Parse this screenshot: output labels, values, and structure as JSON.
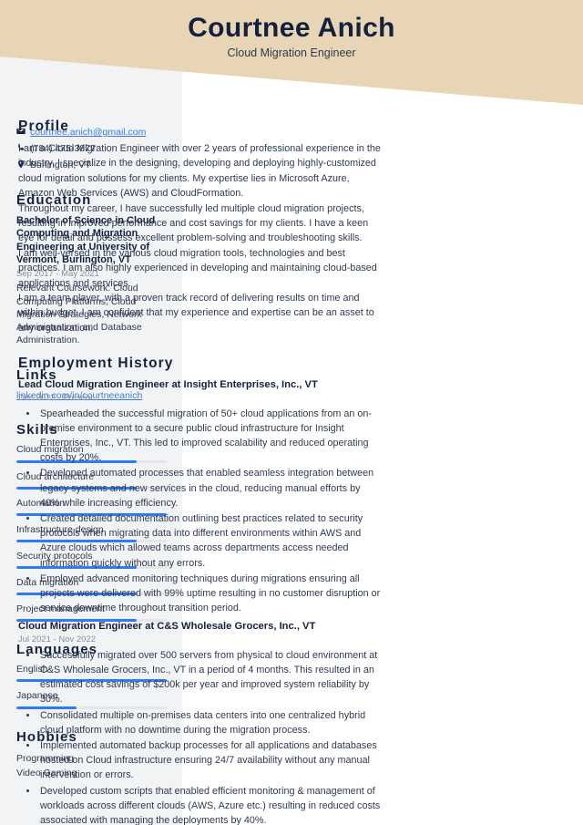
{
  "theme": {
    "banner_color": "#e8d5b5",
    "sidebar_color": "#f2f3f5",
    "accent_bar_color": "#2f7bf6",
    "heading_color": "#14213d",
    "link_color": "#3b7ddd"
  },
  "header": {
    "name": "Courtnee Anich",
    "job_title": "Cloud Migration Engineer"
  },
  "contact": {
    "email": "courtnee.anich@gmail.com",
    "phone": "(784) 475-3877",
    "location": "Burlington, VT"
  },
  "education": {
    "heading": "Education",
    "degree": "Bachelor of Science in Cloud Computing and Migration Engineering at University of Vermont, Burlington, VT",
    "date": "Sep 2017 - May 2021",
    "description": "Relevant Coursework: Cloud Computing Platforms, Cloud Migration Strategies, Network Administration, and Database Administration."
  },
  "links": {
    "heading": "Links",
    "items": [
      {
        "label": "linkedin.com/in/courtneeanich"
      }
    ]
  },
  "skills": {
    "heading": "Skills",
    "items": [
      {
        "label": "Cloud migration",
        "level": 80
      },
      {
        "label": "Cloud architecture",
        "level": 80
      },
      {
        "label": "Automation",
        "level": 100
      },
      {
        "label": "Infrastructure design",
        "level": 80
      },
      {
        "label": "Security protocols",
        "level": 80
      },
      {
        "label": "Data migration",
        "level": 80
      },
      {
        "label": "Project management",
        "level": 80
      }
    ]
  },
  "languages": {
    "heading": "Languages",
    "items": [
      {
        "label": "English",
        "level": 100
      },
      {
        "label": "Japanese",
        "level": 40
      }
    ]
  },
  "hobbies": {
    "heading": "Hobbies",
    "items": [
      {
        "label": "Programming"
      },
      {
        "label": "Video Gaming"
      }
    ]
  },
  "profile": {
    "heading": "Profile",
    "paragraphs": [
      "I am a Cloud Migration Engineer with over 2 years of professional experience in the industry. I specialize in the designing, developing and deploying highly-customized cloud migration solutions for my clients. My expertise lies in Microsoft Azure, Amazon Web Services (AWS) and CloudFormation.",
      "Throughout my career, I have successfully led multiple cloud migration projects, resulting in improved performance and cost savings for my clients. I have a keen eye for detail and possess excellent problem-solving and troubleshooting skills.",
      "I am well-versed in the various cloud migration tools, technologies and best practices. I am also highly experienced in developing and maintaining cloud-based applications and services.",
      "I am a team player, with a proven track record of delivering results on time and within budget. I am confident that my experience and expertise can be an asset to any organization."
    ]
  },
  "employment": {
    "heading": "Employment History",
    "jobs": [
      {
        "title": "Lead Cloud Migration Engineer at Insight Enterprises, Inc., VT",
        "date": "Dec 2022 - Present",
        "bullets": [
          "Spearheaded the successful migration of 50+ cloud applications from an on-premise environment to a secure public cloud infrastructure for Insight Enterprises, Inc., VT. This led to improved scalability and reduced operating costs by 20%.",
          "Developed automated processes that enabled seamless integration between legacy systems and new services in the cloud, reducing manual efforts by 40% while increasing efficiency.",
          "Created detailed documentation outlining best practices related to security protocols when migrating data into different environments within AWS and Azure clouds which allowed teams across departments access needed information quickly without any errors.",
          "Employed advanced monitoring techniques during migrations ensuring all projects were delivered with 99% uptime resulting in no customer disruption or service downtime throughout transition period."
        ]
      },
      {
        "title": "Cloud Migration Engineer at C&S Wholesale Grocers, Inc., VT",
        "date": "Jul 2021 - Nov 2022",
        "bullets": [
          "Successfully migrated over 500 servers from physical to cloud environment at C&S Wholesale Grocers, Inc., VT in a period of 4 months. This resulted in an estimated cost savings of $200k per year and improved system reliability by 30%.",
          "Consolidated multiple on-premises data centers into one centralized hybrid cloud platform with no downtime during the migration process.",
          "Implemented automated backup processes for all applications and databases hosted on Cloud infrastructure ensuring 24/7 availability without any manual intervention or errors.",
          "Developed custom scripts that enabled efficient monitoring & management of workloads across different clouds (AWS, Azure etc.) resulting in reduced costs associated with managing the deployments by 40%."
        ]
      }
    ]
  }
}
